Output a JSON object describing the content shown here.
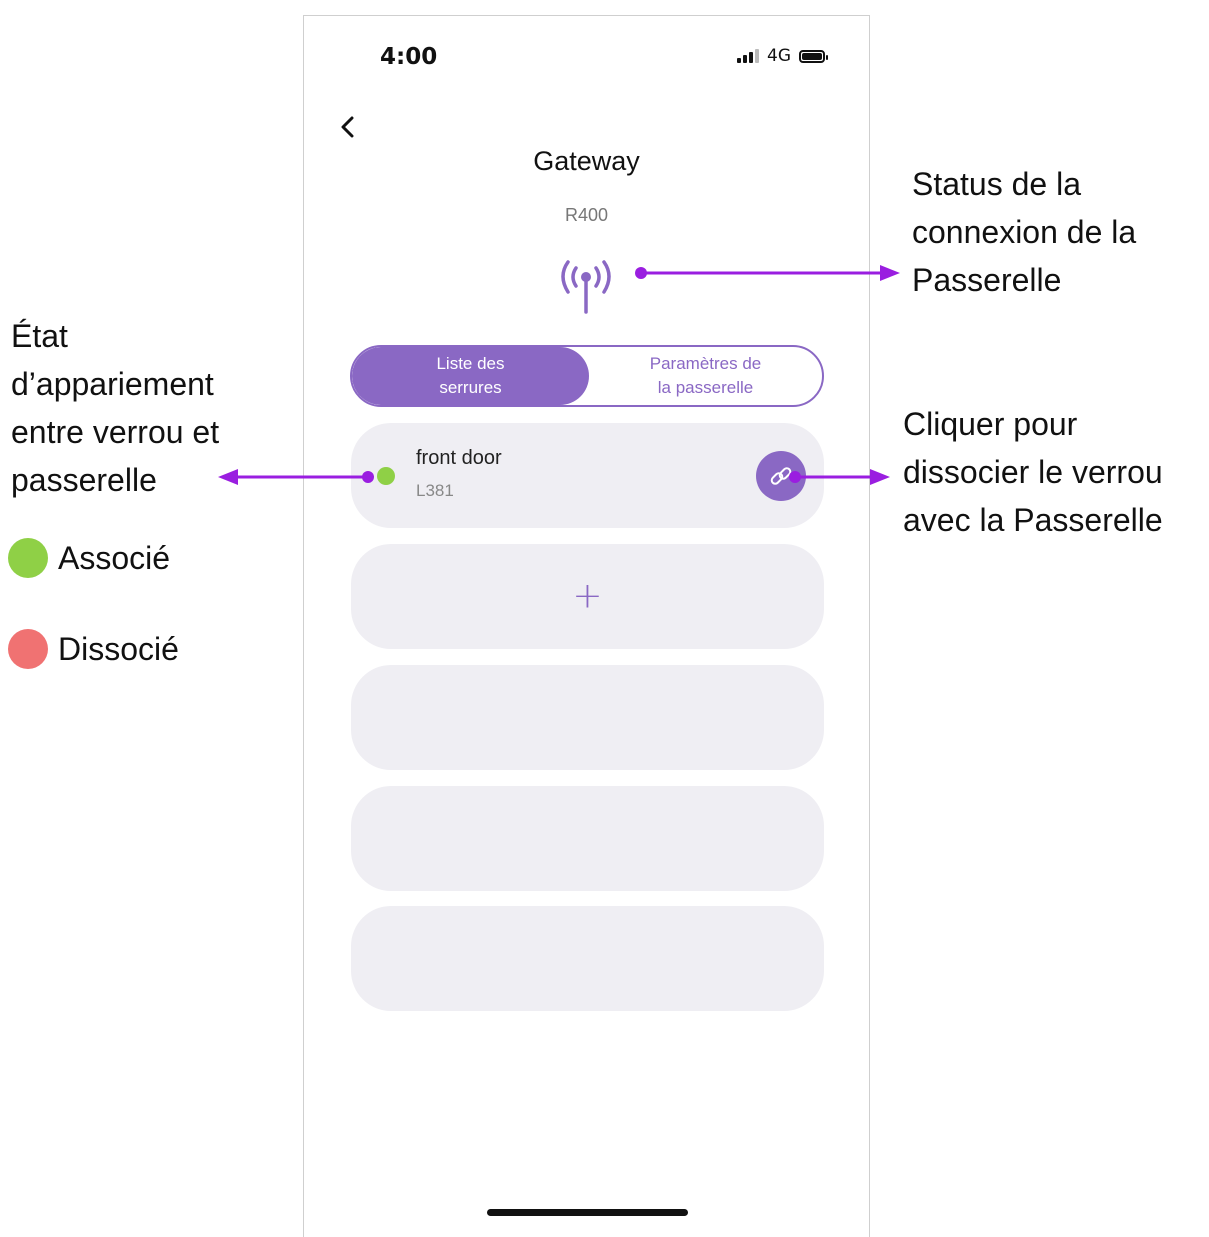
{
  "status_bar": {
    "time": "4:00",
    "network": "4G"
  },
  "header": {
    "title": "Gateway",
    "model": "R400"
  },
  "tabs": [
    {
      "label": "Liste des\nserrures",
      "active": true
    },
    {
      "label": "Paramètres de\nla passerelle",
      "active": false
    }
  ],
  "locks": [
    {
      "name": "front door",
      "model": "L381",
      "status_color": "#8fd046"
    }
  ],
  "add_label": "+",
  "annotations": {
    "connection_status": "Status de la\nconnexion de la\nPasserelle",
    "pairing_state": "État\nd’appariement\nentre verrou et\npasserelle",
    "unlink_hint": "Cliquer pour\ndissocier le verrou\navec la Passerelle",
    "legend": [
      {
        "label": "Associé",
        "color": "#8fd046"
      },
      {
        "label": "Dissocié",
        "color": "#f07272"
      }
    ]
  },
  "colors": {
    "accent": "#8a68c4",
    "arrow": "#9a1ee0",
    "card_bg": "#efeef3"
  }
}
